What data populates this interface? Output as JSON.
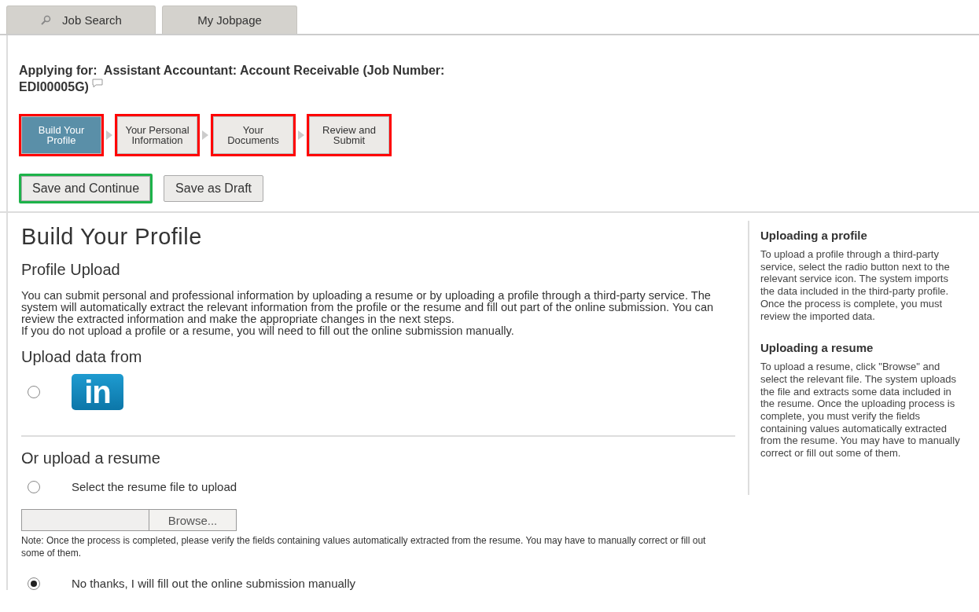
{
  "tabs": [
    {
      "label": "Job Search",
      "icon": true,
      "selected": false
    },
    {
      "label": "My Jobpage",
      "icon": false,
      "selected": false
    }
  ],
  "applying": {
    "label": "Applying for:",
    "job": "Assistant Accountant: Account Receivable (Job Number: EDI00005G)"
  },
  "steps": [
    {
      "label": "Build Your Profile",
      "selected": true,
      "outlined": true
    },
    {
      "label": "Your Personal Information",
      "selected": false,
      "outlined": true
    },
    {
      "label": "Your Documents",
      "selected": false,
      "outlined": true
    },
    {
      "label": "Review and Submit",
      "selected": false,
      "outlined": true
    }
  ],
  "buttons": [
    {
      "label": "Save and Continue",
      "highlighted": true
    },
    {
      "label": "Save as Draft",
      "highlighted": false
    }
  ],
  "main": {
    "title": "Build Your Profile",
    "subtitle": "Profile Upload",
    "paragraphs": [
      "You can submit personal and professional information by uploading a resume or by uploading a profile through a third-party service. The system will automatically extract the relevant information from the profile or the resume and fill out part of the online submission. You can review the extracted information and make the appropriate changes in the next steps.",
      "If you do not upload a profile or a resume, you will need to fill out the online submission manually."
    ],
    "upload_heading": "Upload data from",
    "linkedin_option": {
      "selected": false,
      "logo": "in"
    },
    "resume_heading": "Or upload a resume",
    "resume_option": {
      "label": "Select the resume file to upload",
      "selected": false
    },
    "browse_button": "Browse...",
    "note": "Note: Once the process is completed, please verify the fields containing values automatically extracted from the resume. You may have to manually correct or fill out some of them.",
    "manual_option": {
      "label": "No thanks, I will fill out the online submission manually",
      "selected": true
    }
  },
  "sidebar": [
    {
      "heading": "Uploading a profile",
      "text": "To upload a profile through a third-party service, select the radio button next to the relevant service icon. The system imports the data included in the third-party profile. Once the process is complete, you must review the imported data."
    },
    {
      "heading": "Uploading a resume",
      "text": "To upload a resume, click \"Browse\" and select the relevant file. The system uploads the file and extracts some data included in the resume. Once the uploading process is complete, you must verify the fields containing values automatically extracted from the resume. You may have to manually correct or fill out some of them."
    }
  ]
}
